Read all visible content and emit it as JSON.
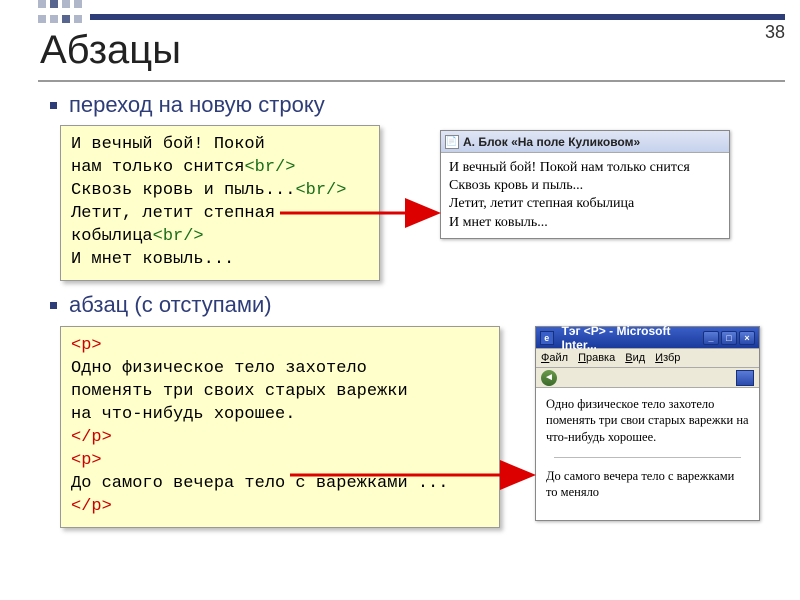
{
  "page_number": "38",
  "title": "Абзацы",
  "bullet1": "переход на новую строку",
  "bullet2": "абзац (с отступами)",
  "code1": {
    "l1": "И вечный бой! Покой",
    "l2a": "нам только снится",
    "br": "<br/>",
    "l3a": "Сквозь кровь и пыль...",
    "l4": "Летит, летит степная",
    "l5a": "кобылица",
    "l6": "И мнет ковыль..."
  },
  "browser1": {
    "title": "А. Блок «На поле Куликовом»",
    "t1": "И вечный бой! Покой нам только снится",
    "t2": "Сквозь кровь и пыль...",
    "t3": "Летит, летит степная кобылица",
    "t4": "И мнет ковыль..."
  },
  "code2": {
    "open": "<p>",
    "l1": "Одно физическое тело захотело",
    "l2": "поменять три своих старых варежки",
    "l3": "на что-нибудь хорошее.",
    "close": "</p>",
    "l4": "До самого вечера тело с варежками ..."
  },
  "browser2": {
    "title": "Тэг <P> - Microsoft Inter...",
    "menu": {
      "file": "Файл",
      "edit": "Правка",
      "view": "Вид",
      "fav": "Избр"
    },
    "p1": "Одно физическое тело захотело поменять три свои старых варежки на что-нибудь хорошее.",
    "p2": "До самого вечера тело с варежками то меняло"
  }
}
